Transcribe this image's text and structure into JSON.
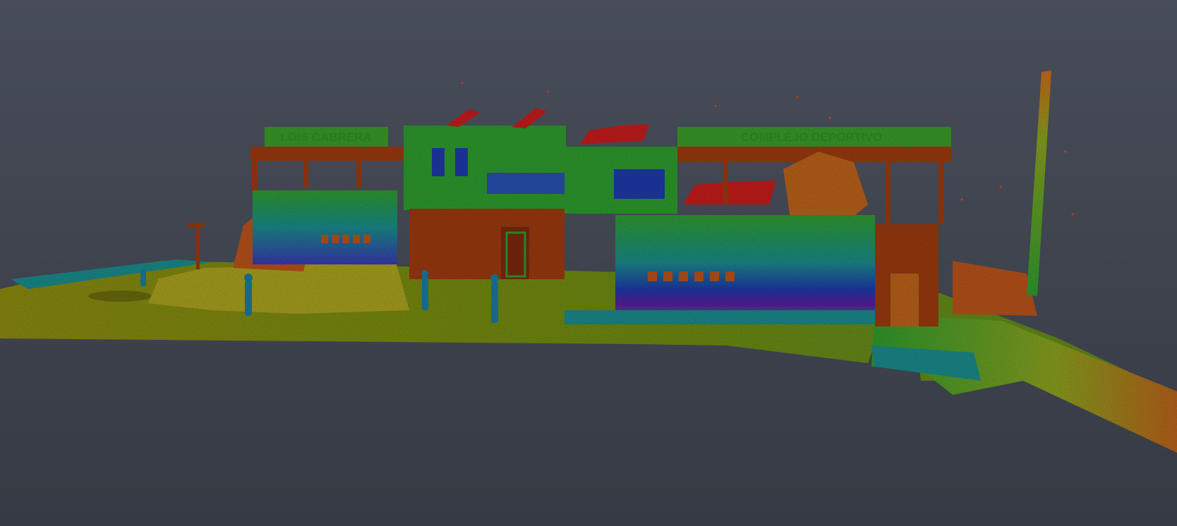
{
  "viewer": {
    "background_top": "#474d59",
    "background_bottom": "#363a43"
  },
  "point_cloud": {
    "color_scale": [
      "#5a0f7a",
      "#1f3aa8",
      "#1a8a8a",
      "#2e9a2e",
      "#8aa020",
      "#c9a020",
      "#b8521a",
      "#9a2a10"
    ],
    "sign_left_text": "LOIS CABRERA",
    "sign_right_text": "COMPLEJO DEPORTIVO"
  }
}
